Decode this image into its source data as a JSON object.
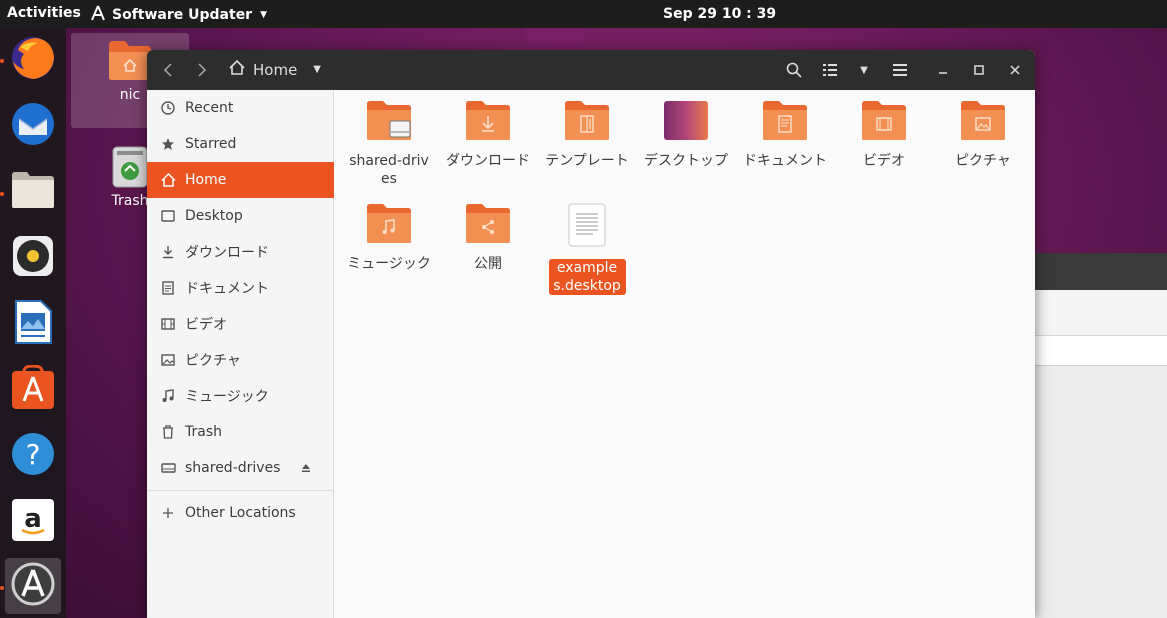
{
  "topbar": {
    "activities": "Activities",
    "app_name": "Software Updater",
    "clock": "Sep 29  10 : 39"
  },
  "desktop": {
    "icons": [
      {
        "label": "nic",
        "icon": "home-folder-icon"
      },
      {
        "label": "Trash",
        "icon": "trash-icon"
      }
    ]
  },
  "dock": {
    "apps": [
      {
        "name": "firefox",
        "icon": "firefox-icon",
        "running": true
      },
      {
        "name": "thunderbird",
        "icon": "thunderbird-icon",
        "running": false
      },
      {
        "name": "files",
        "icon": "files-icon",
        "running": true
      },
      {
        "name": "rhythmbox",
        "icon": "rhythmbox-icon",
        "running": false
      },
      {
        "name": "writer",
        "icon": "libreoffice-writer-icon",
        "running": false
      },
      {
        "name": "software",
        "icon": "ubuntu-software-icon",
        "running": false
      },
      {
        "name": "help",
        "icon": "help-icon",
        "running": false
      },
      {
        "name": "amazon",
        "icon": "amazon-icon",
        "running": false
      },
      {
        "name": "software-updater",
        "icon": "software-updater-icon",
        "running": true
      }
    ]
  },
  "window": {
    "path_label": "Home",
    "sidebar": [
      {
        "label": "Recent",
        "icon": "clock-icon"
      },
      {
        "label": "Starred",
        "icon": "star-icon"
      },
      {
        "label": "Home",
        "icon": "home-icon",
        "active": true
      },
      {
        "label": "Desktop",
        "icon": "desktop-icon"
      },
      {
        "label": "ダウンロード",
        "icon": "download-icon"
      },
      {
        "label": "ドキュメント",
        "icon": "document-icon"
      },
      {
        "label": "ビデオ",
        "icon": "video-icon"
      },
      {
        "label": "ピクチャ",
        "icon": "picture-icon"
      },
      {
        "label": "ミュージック",
        "icon": "music-icon"
      },
      {
        "label": "Trash",
        "icon": "trash-icon"
      },
      {
        "label": "shared-drives",
        "icon": "drive-icon"
      },
      {
        "label": "Other Locations",
        "icon": "plus-icon"
      }
    ],
    "files": [
      {
        "label": "shared-drives",
        "icon": "drive-folder-icon"
      },
      {
        "label": "ダウンロード",
        "icon": "download-folder-icon"
      },
      {
        "label": "テンプレート",
        "icon": "templates-folder-icon"
      },
      {
        "label": "デスクトップ",
        "icon": "desktop-folder-icon"
      },
      {
        "label": "ドキュメント",
        "icon": "documents-folder-icon"
      },
      {
        "label": "ビデオ",
        "icon": "videos-folder-icon"
      },
      {
        "label": "ピクチャ",
        "icon": "pictures-folder-icon"
      },
      {
        "label": "ミュージック",
        "icon": "music-folder-icon"
      },
      {
        "label": "公開",
        "icon": "public-folder-icon"
      },
      {
        "label": "examples.desktop",
        "icon": "text-file-icon",
        "selected": true
      }
    ]
  },
  "colors": {
    "accent": "#e95420",
    "folder": "#f08a4b",
    "headerbar": "#2d2d2d",
    "topbar": "#1d1d1d"
  }
}
